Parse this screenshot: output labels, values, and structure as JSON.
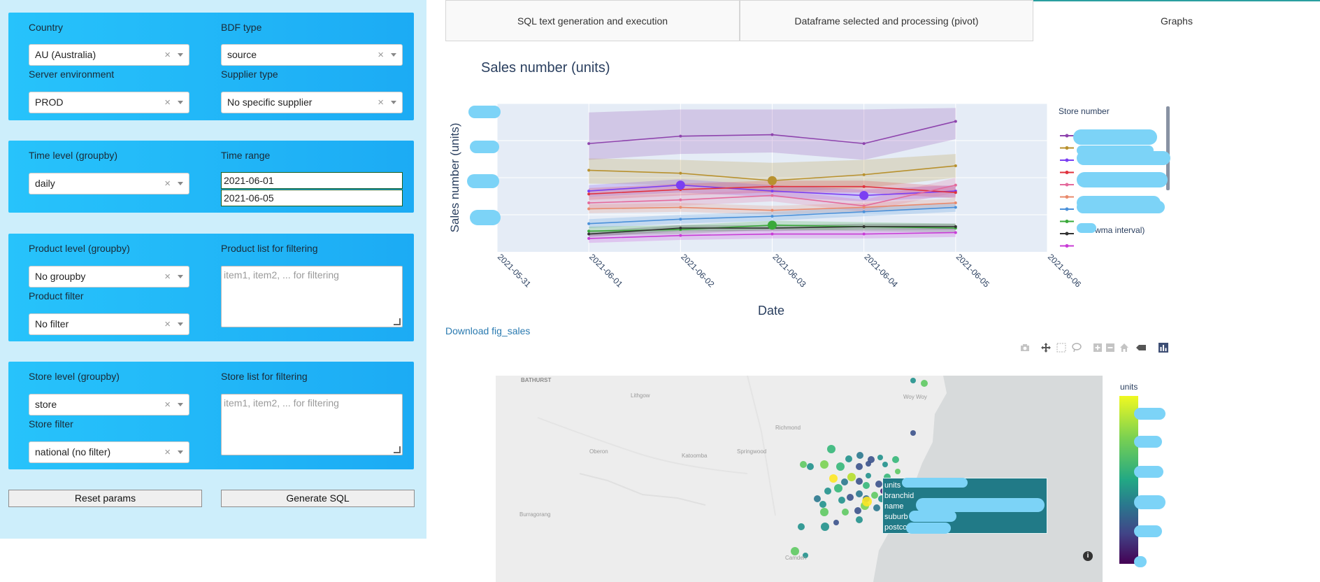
{
  "sidebar": {
    "country": {
      "label": "Country",
      "value": "AU (Australia)"
    },
    "bdf_type": {
      "label": "BDF type",
      "value": "source"
    },
    "server_env": {
      "label": "Server environment",
      "value": "PROD"
    },
    "supplier_type": {
      "label": "Supplier type",
      "value": "No specific supplier"
    },
    "time_level": {
      "label": "Time level (groupby)",
      "value": "daily"
    },
    "time_range": {
      "label": "Time range",
      "start": "2021-06-01",
      "end": "2021-06-05"
    },
    "product_level": {
      "label": "Product level (groupby)",
      "value": "No groupby"
    },
    "product_list": {
      "label": "Product list for filtering",
      "placeholder": "item1, item2, ... for filtering"
    },
    "product_filter": {
      "label": "Product filter",
      "value": "No filter"
    },
    "store_level": {
      "label": "Store level (groupby)",
      "value": "store"
    },
    "store_list": {
      "label": "Store list for filtering",
      "placeholder": "item1, item2, ... for filtering"
    },
    "store_filter": {
      "label": "Store filter",
      "value": "national (no filter)"
    },
    "clear_glyph": "×",
    "buttons": {
      "reset": "Reset params",
      "generate": "Generate SQL"
    }
  },
  "tabs": [
    {
      "label": "SQL text generation and execution",
      "active": false
    },
    {
      "label": "Dataframe selected and processing (pivot)",
      "active": false
    },
    {
      "label": "Graphs",
      "active": true
    }
  ],
  "chart_data": {
    "type": "line",
    "title": "Sales number (units)",
    "xlabel": "Date",
    "ylabel": "Sales number (units)",
    "x": [
      "2021-06-01",
      "2021-06-02",
      "2021-06-03",
      "2021-06-04",
      "2021-06-05"
    ],
    "x_ticks": [
      "2021-05-31",
      "2021-06-01",
      "2021-06-02",
      "2021-06-03",
      "2021-06-04",
      "2021-06-05",
      "2021-06-06"
    ],
    "y_range": [
      0,
      100
    ],
    "grid": true,
    "legend_title": "Store number",
    "legend_placement": "right",
    "legend_fragments": [
      "wma interval)"
    ],
    "series": [
      {
        "color": "#8e44ad",
        "values": [
          73,
          78,
          79,
          73,
          88
        ],
        "band": [
          [
            62,
            94
          ],
          [
            66,
            96
          ],
          [
            67,
            96
          ],
          [
            62,
            96
          ],
          [
            76,
            97
          ]
        ]
      },
      {
        "color": "#b8912e",
        "values": [
          55,
          53,
          48,
          52,
          58
        ],
        "band": [
          [
            46,
            63
          ],
          [
            45,
            62
          ],
          [
            40,
            60
          ],
          [
            43,
            62
          ],
          [
            50,
            66
          ]
        ]
      },
      {
        "color": "#7b3ff2",
        "values": [
          41,
          45,
          41,
          38,
          41
        ],
        "band": [
          [
            37,
            45
          ],
          [
            40,
            49
          ],
          [
            37,
            45
          ],
          [
            34,
            42
          ],
          [
            37,
            45
          ]
        ]
      },
      {
        "color": "#e0323e",
        "values": [
          39,
          42,
          44,
          44,
          40
        ],
        "band": [
          [
            35,
            43
          ],
          [
            38,
            46
          ],
          [
            40,
            48
          ],
          [
            40,
            48
          ],
          [
            36,
            44
          ]
        ]
      },
      {
        "color": "#e46a9c",
        "values": [
          33,
          35,
          38,
          31,
          45
        ],
        "band": [
          [
            29,
            37
          ],
          [
            31,
            39
          ],
          [
            34,
            42
          ],
          [
            27,
            35
          ],
          [
            40,
            50
          ]
        ]
      },
      {
        "color": "#e98a6c",
        "values": [
          29,
          30,
          28,
          30,
          33
        ],
        "band": [
          [
            26,
            32
          ],
          [
            27,
            33
          ],
          [
            25,
            31
          ],
          [
            27,
            33
          ],
          [
            30,
            36
          ]
        ]
      },
      {
        "color": "#4a90d9",
        "values": [
          19,
          22,
          24,
          27,
          30
        ],
        "band": [
          [
            16,
            22
          ],
          [
            19,
            25
          ],
          [
            21,
            27
          ],
          [
            24,
            30
          ],
          [
            27,
            33
          ]
        ]
      },
      {
        "color": "#3aa93a",
        "values": [
          14,
          15,
          18,
          17,
          16
        ],
        "band": [
          [
            11,
            17
          ],
          [
            12,
            18
          ],
          [
            15,
            21
          ],
          [
            14,
            20
          ],
          [
            13,
            19
          ]
        ]
      },
      {
        "color": "#333333",
        "values": [
          12,
          16,
          16,
          17,
          17
        ],
        "band": [
          [
            10,
            14
          ],
          [
            14,
            18
          ],
          [
            14,
            18
          ],
          [
            15,
            19
          ],
          [
            15,
            19
          ]
        ]
      },
      {
        "color": "#c83cd6",
        "values": [
          9,
          11,
          12,
          12,
          13
        ],
        "band": [
          [
            6,
            12
          ],
          [
            8,
            14
          ],
          [
            9,
            15
          ],
          [
            9,
            15
          ],
          [
            10,
            16
          ]
        ]
      }
    ],
    "highlight_points": [
      {
        "series": 2,
        "index": 1
      },
      {
        "series": 1,
        "index": 2
      },
      {
        "series": 7,
        "index": 2
      },
      {
        "series": 2,
        "index": 3
      }
    ]
  },
  "download_link": "Download fig_sales",
  "toolbar_icons": [
    "camera-icon",
    "pan-icon",
    "box-select-icon",
    "lasso-icon",
    "zoom-in-icon",
    "zoom-out-icon",
    "home-icon",
    "toggle-spikelines-icon",
    "plotly-logo-icon"
  ],
  "map": {
    "labels": [
      "BATHURST",
      "Lithgow",
      "Oberon",
      "Katoomba",
      "Springwood",
      "Richmond",
      "Burragorang",
      "Woy Woy",
      "Camden"
    ],
    "tooltip": [
      "units",
      "branchid",
      "name",
      "suburb",
      "postcode"
    ],
    "colorbar_title": "units",
    "colors": {
      "water": "#d7dadb",
      "land": "#ededed"
    }
  }
}
